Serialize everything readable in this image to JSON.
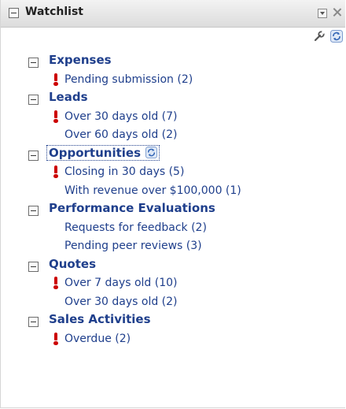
{
  "portlet": {
    "title": "Watchlist",
    "icons": {
      "title_collapse": "collapse-box-icon",
      "minimize": "minimize-icon",
      "close": "close-icon",
      "settings": "wrench-icon",
      "refresh": "refresh-icon"
    },
    "colors": {
      "link": "#1f3f8c",
      "alert": "#cc0000",
      "titlebar": "#e6e6e6"
    }
  },
  "groups": [
    {
      "label": "Expenses",
      "items": [
        {
          "text": "Pending submission (2)",
          "alert": true
        }
      ]
    },
    {
      "label": "Leads",
      "items": [
        {
          "text": "Over 30 days old (7)",
          "alert": true
        },
        {
          "text": "Over 60 days old (2)",
          "alert": false
        }
      ]
    },
    {
      "label": "Opportunities",
      "items": [
        {
          "text": "Closing in 30 days (5)",
          "alert": true
        },
        {
          "text": "With revenue over $100,000 (1)",
          "alert": false
        }
      ]
    },
    {
      "label": "Performance Evaluations",
      "items": [
        {
          "text": "Requests for feedback (2)",
          "alert": false
        },
        {
          "text": "Pending peer reviews (3)",
          "alert": false
        }
      ]
    },
    {
      "label": "Quotes",
      "items": [
        {
          "text": "Over 7 days old (10)",
          "alert": true
        },
        {
          "text": "Over 30 days old (2)",
          "alert": false
        }
      ]
    },
    {
      "label": "Sales Activities",
      "items": [
        {
          "text": "Overdue (2)",
          "alert": true
        }
      ]
    }
  ]
}
